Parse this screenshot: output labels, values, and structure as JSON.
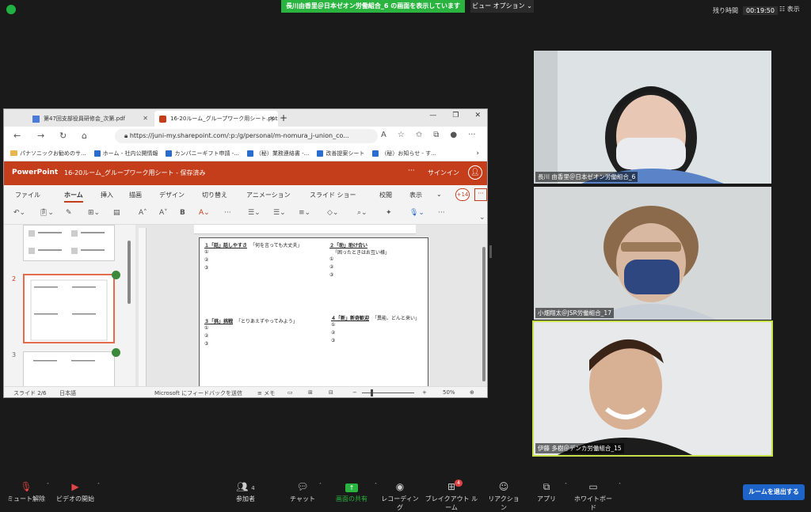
{
  "topbar": {
    "share_banner": "長川由香里＠日本ゼオン労働組合_6 の画面を表示しています",
    "view_options": "ビュー オプション ⌄",
    "remaining_label": "残り時間",
    "remaining_time": "00:19:50",
    "view_label": "表示"
  },
  "browser": {
    "tab1_label": "第47回支部役員研修会_次第.pdf",
    "tab2_label": "16-20ルーム_グループワーク用シート.pptx",
    "url": "https://juni-my.sharepoint.com/:p:/g/personal/m-nomura_j-union_co...",
    "favorites": [
      "パナソニックお勧めのサ...",
      "ホーム - 社内公開情報",
      "カンパニーギフト申請 -...",
      "（秘）業務連絡書 -...",
      "改善提案シート",
      "（秘）お知らせ - す..."
    ]
  },
  "ppt": {
    "app_name": "PowerPoint",
    "file_title": "16-20ルーム_グループワーク用シート - 保存済み",
    "more": "···",
    "signin": "サインイン",
    "tabs": [
      "ファイル",
      "ホーム",
      "挿入",
      "描画",
      "デザイン",
      "切り替え",
      "アニメーション",
      "スライド ショー",
      "校閲",
      "表示"
    ],
    "badge": "+14",
    "slide_numbers": [
      "2",
      "3"
    ],
    "slide": {
      "q1_title": "１「話」話しやすさ",
      "q1_sub": "「何を言っても大丈夫」",
      "q2_title": "２「助」助け合い",
      "q2_sub": "「困ったときはお互い様」",
      "q3_title": "３「挑」挑戦",
      "q3_sub": "「とりあえずやってみよう」",
      "q4_title": "４「新」新奇歓迎",
      "q4_sub": "「異能、どんと来い」",
      "n1": "①",
      "n2": "②",
      "n3": "③"
    },
    "status": {
      "slide_count": "スライド 2/6",
      "language": "日本語",
      "feedback": "Microsoft にフィードバックを送信",
      "notes": "メモ",
      "zoom": "50%"
    }
  },
  "videos": [
    {
      "name": "長川 由香里＠日本ゼオン労働組合_6"
    },
    {
      "name": "小畑翔太＠JSR労働組合_17"
    },
    {
      "name": "伊藤 多樹＠デンカ労働組合_15"
    }
  ],
  "bottombar": {
    "mute": "ミュート解除",
    "video": "ビデオの開始",
    "participants": "参加者",
    "participants_count": "4",
    "chat": "チャット",
    "share": "画面の共有",
    "record": "レコーディング",
    "breakout": "ブレイクアウト ルーム",
    "breakout_badge": "4",
    "reactions": "リアクション",
    "apps": "アプリ",
    "whiteboard": "ホワイトボード",
    "leave": "ルームを退出する"
  },
  "colors": {
    "ppt_red": "#c43e1c",
    "zoom_green": "#2bb340",
    "leave_blue": "#1d63c8",
    "active_speaker": "#c8e04a"
  }
}
